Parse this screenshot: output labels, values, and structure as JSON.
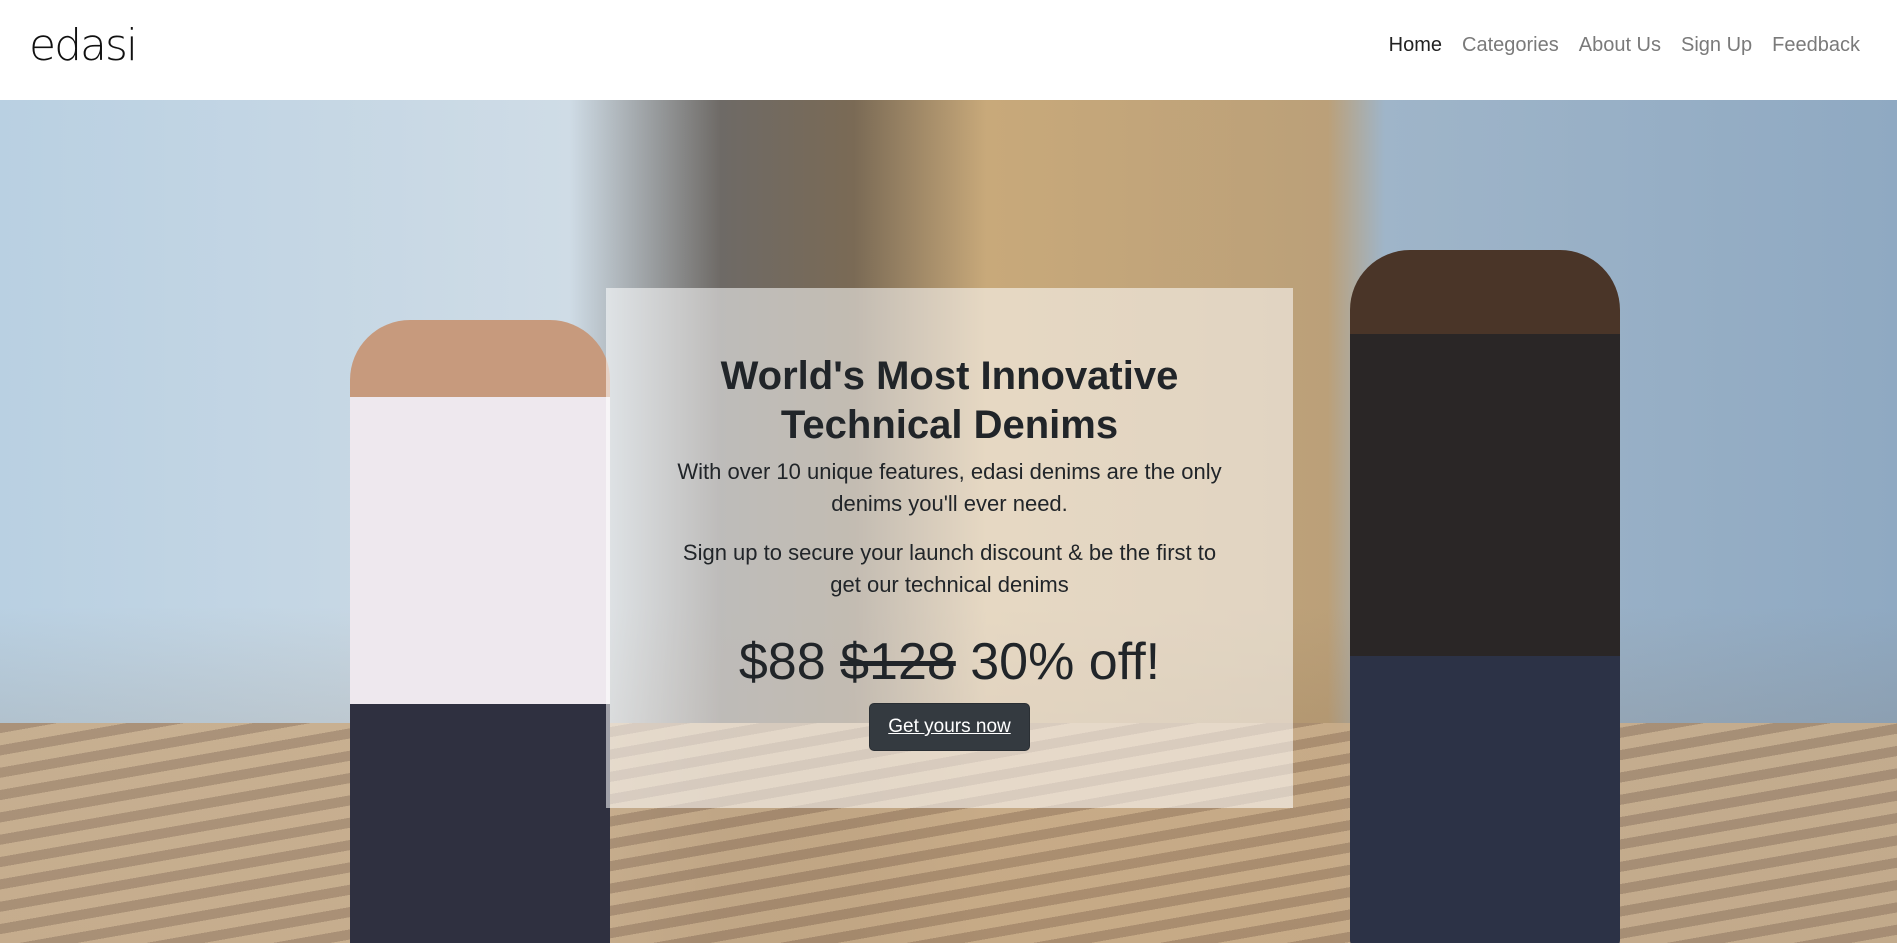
{
  "brand": "edasi",
  "nav": [
    {
      "label": "Home",
      "active": true
    },
    {
      "label": "Categories"
    },
    {
      "label": "About Us"
    },
    {
      "label": "Sign Up"
    },
    {
      "label": "Feedback"
    }
  ],
  "hero": {
    "title": "World's Most Innovative Technical Denims",
    "text1": "With over 10 unique features, edasi denims are the only denims you'll ever need.",
    "text2": "Sign up to secure your launch discount & be the first to get our technical denims",
    "price": "$88",
    "old_price": "$128",
    "discount": "30% off!",
    "cta": "Get yours now"
  }
}
